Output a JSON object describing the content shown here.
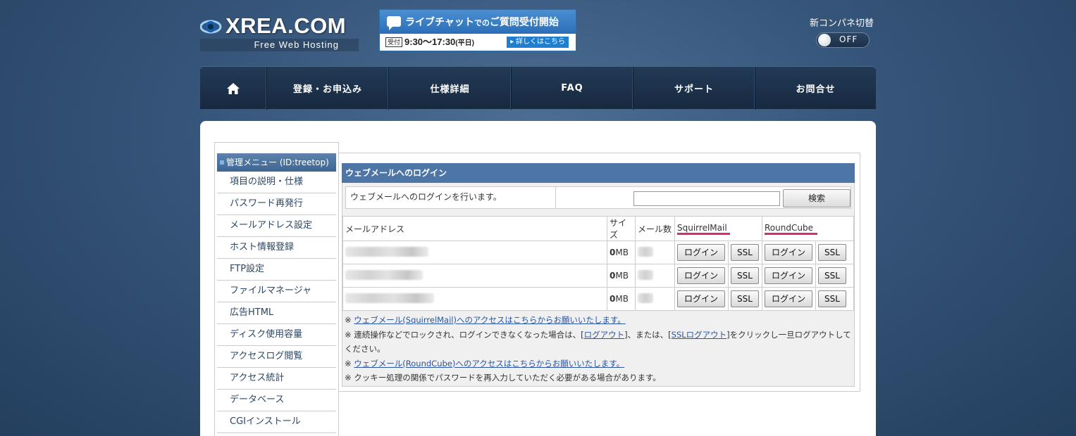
{
  "header": {
    "logo_text": "XREA.COM",
    "logo_sub": "Free Web Hosting",
    "chat_banner": {
      "title_a": "ライブチャット",
      "title_small": "での",
      "title_b": "ご質問受付開始",
      "tag": "受付",
      "hours": "9:30～17:30",
      "paren": "(平日)",
      "more": "▸ 詳しくはこちら"
    },
    "toggle_label": "新コンパネ切替",
    "toggle_state": "OFF"
  },
  "nav": {
    "items": [
      "登録・お申込み",
      "仕様詳細",
      "FAQ",
      "サポート",
      "お問合せ"
    ]
  },
  "sidebar": {
    "title": "管理メニュー (ID:treetop)",
    "items": [
      "項目の説明・仕様",
      "パスワード再発行",
      "メールアドレス設定",
      "ホスト情報登録",
      "FTP設定",
      "ファイルマネージャ",
      "広告HTML",
      "ディスク使用容量",
      "アクセスログ閲覧",
      "アクセス統計",
      "データベース",
      "CGIインストール"
    ]
  },
  "webmail": {
    "title": "ウェブメールへのログイン",
    "description": "ウェブメールへのログインを行います。",
    "search_button": "検索",
    "columns": {
      "address": "メールアドレス",
      "size": "サイズ",
      "count": "メール数",
      "squirrel": "SquirrelMail",
      "roundcube": "RoundCube"
    },
    "rows": [
      {
        "size_num": "0",
        "size_unit": "MB"
      },
      {
        "size_num": "0",
        "size_unit": "MB"
      },
      {
        "size_num": "0",
        "size_unit": "MB"
      }
    ],
    "login_label": "ログイン",
    "ssl_label": "SSL",
    "notes": {
      "mark": "※",
      "note1_link": "ウェブメール(SquirrelMail)へのアクセスはこちらからお願いいたします。",
      "note2_pre": "連続操作などでロックされ、ログインできなくなった場合は、[",
      "note2_link1": "ログアウト",
      "note2_mid": "]、または、[",
      "note2_link2": "SSLログアウト",
      "note2_post": "]をクリックし一旦ログアウトしてください。",
      "note3_link": "ウェブメール(RoundCube)へのアクセスはこちらからお願いいたします。",
      "note4": "クッキー処理の関係でパスワードを再入力していただく必要がある場合があります。"
    }
  },
  "colors": {
    "background": "#36557a",
    "nav": "#1b2f47",
    "section_title": "#4d75a5",
    "highlight": "#e0287a"
  }
}
